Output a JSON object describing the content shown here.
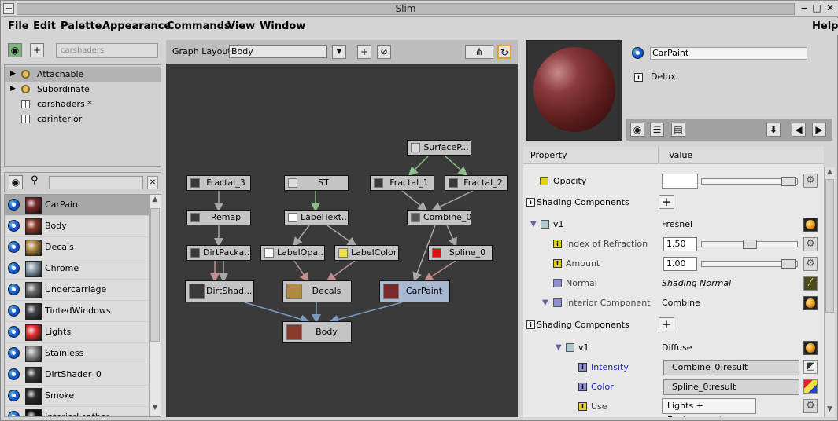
{
  "window": {
    "title": "Slim"
  },
  "menu": [
    "File",
    "Edit",
    "Palette",
    "Appearance",
    "Commands",
    "View",
    "Window"
  ],
  "help_label": "Help",
  "left": {
    "search_placeholder": "carshaders",
    "tree": [
      {
        "label": "Attachable",
        "icon": "gear-icon",
        "expander": true
      },
      {
        "label": "Subordinate",
        "icon": "gear-icon",
        "expander": true
      },
      {
        "label": "carshaders *",
        "icon": "grid-icon",
        "expander": false
      },
      {
        "label": "carinterior",
        "icon": "grid-icon",
        "expander": false
      }
    ],
    "list": [
      {
        "label": "CarPaint",
        "thumb": "#7a2a2a"
      },
      {
        "label": "Body",
        "thumb": "#8a3a2a"
      },
      {
        "label": "Decals",
        "thumb": "#b08a40"
      },
      {
        "label": "Chrome",
        "thumb": "#8aa0b0"
      },
      {
        "label": "Undercarriage",
        "thumb": "#6a6a6a"
      },
      {
        "label": "TintedWindows",
        "thumb": "#404048"
      },
      {
        "label": "Lights",
        "thumb": "#e83030"
      },
      {
        "label": "Stainless",
        "thumb": "#909090"
      },
      {
        "label": "DirtShader_0",
        "thumb": "#383838"
      },
      {
        "label": "Smoke",
        "thumb": "#2a2a2a"
      },
      {
        "label": "InteriorLeather",
        "thumb": "#101010"
      }
    ]
  },
  "graph": {
    "layout_label": "Graph Layout",
    "layout_value": "Body",
    "nodes": [
      {
        "label": "SurfaceP...",
        "icon": "#dcdcdc"
      },
      {
        "label": "Fractal_3",
        "icon": "#3a3a3a"
      },
      {
        "label": "ST",
        "icon": "#dcdcdc"
      },
      {
        "label": "Fractal_1",
        "icon": "#3a3a3a"
      },
      {
        "label": "Fractal_2",
        "icon": "#3a3a3a"
      },
      {
        "label": "Remap",
        "icon": "#3a3a3a"
      },
      {
        "label": "LabelText...",
        "icon": "#ffffff"
      },
      {
        "label": "Combine_0",
        "icon": "#555555"
      },
      {
        "label": "DirtPacka...",
        "icon": "#3a3a3a"
      },
      {
        "label": "LabelOpa...",
        "icon": "#ffffff"
      },
      {
        "label": "LabelColor",
        "icon": "#f0e040"
      },
      {
        "label": "Spline_0",
        "icon": "#e01010"
      },
      {
        "label": "DirtShad...",
        "icon": "#3a3a3a"
      },
      {
        "label": "Decals",
        "icon": "#b08a40"
      },
      {
        "label": "CarPaint",
        "icon": "#7a2a2a"
      },
      {
        "label": "Body",
        "icon": "#8a3a2a"
      }
    ]
  },
  "right": {
    "shader_name": "CarPaint",
    "shader_type": "Delux",
    "columns": {
      "property": "Property",
      "value": "Value"
    },
    "props": {
      "opacity": {
        "label": "Opacity"
      },
      "shading_components_1": "Shading Components",
      "v1_a": {
        "label": "v1",
        "value": "Fresnel"
      },
      "ior": {
        "label": "Index of Refraction",
        "value": "1.50"
      },
      "amount": {
        "label": "Amount",
        "value": "1.00"
      },
      "normal": {
        "label": "Normal",
        "value": "Shading Normal"
      },
      "interior": {
        "label": "Interior Component",
        "value": "Combine"
      },
      "shading_components_2": "Shading Components",
      "v1_b": {
        "label": "v1",
        "value": "Diffuse"
      },
      "intensity": {
        "label": "Intensity",
        "value": "Combine_0:result"
      },
      "color": {
        "label": "Color",
        "value": "Spline_0:result"
      },
      "use": {
        "label": "Use",
        "value": "Lights + Environments"
      }
    }
  },
  "colors": {
    "link_blue": "#2020c0",
    "graph_bg": "#3a3a3a",
    "selection": "#a6a6a6",
    "accent_orange": "#e8a020"
  }
}
